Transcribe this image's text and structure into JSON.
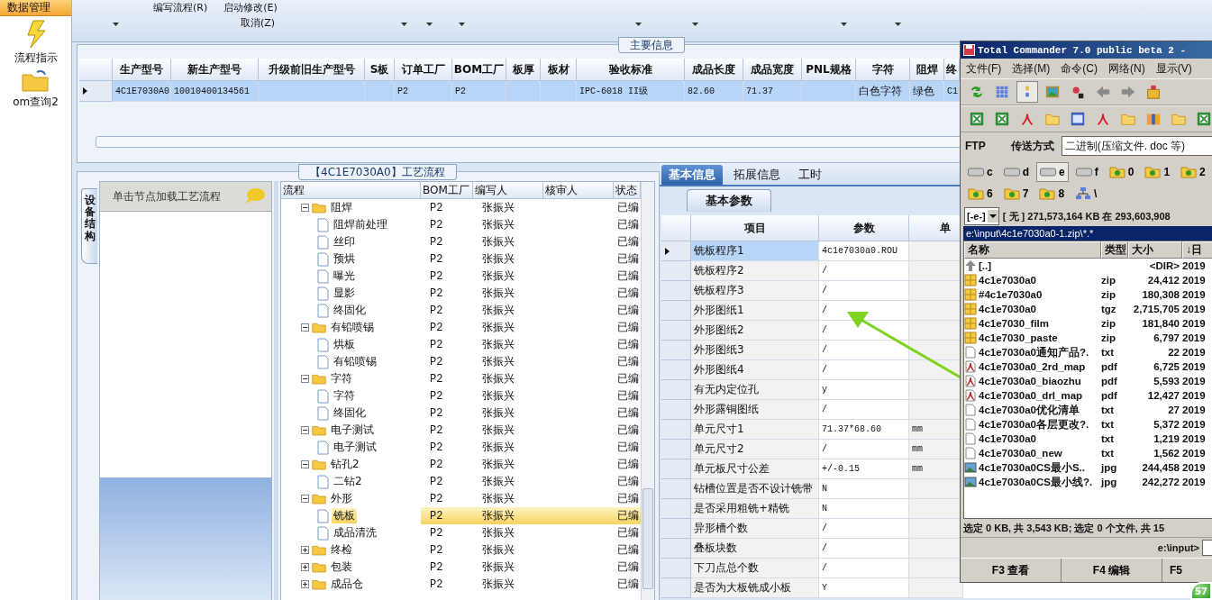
{
  "sidebar": {
    "header": "数据管理",
    "items": [
      {
        "label": "流程指示",
        "kind": "action"
      },
      {
        "label": "om查询2",
        "kind": "folder"
      }
    ]
  },
  "toolbar": {
    "top_items": [
      "编写流程(R)",
      "启动修改(E)"
    ],
    "bottom_item": "取消(Z)"
  },
  "main_info": {
    "title": "主要信息",
    "columns": [
      "生产型号",
      "新生产型号",
      "升级前旧生产型号",
      "S板",
      "订单工厂",
      "BOM工厂",
      "板厚",
      "板材",
      "验收标准",
      "成品长度",
      "成品宽度",
      "PNL规格",
      "字符",
      "阻焊",
      "终"
    ],
    "rows": [
      {
        "selected": true,
        "cells": [
          "4C1E7030A0",
          "10010400134561",
          "",
          "",
          "P2",
          "P2",
          "",
          "",
          "IPC-6018 II级",
          "82.60",
          "71.37",
          "",
          "白色字符",
          "绿色",
          "C1"
        ]
      }
    ]
  },
  "process": {
    "title": "【4C1E7030A0】工艺流程",
    "side_tab": "设备结构",
    "hint": "单击节点加载工艺流程",
    "columns": [
      "流程",
      "BOM工厂",
      "编写人",
      "核审人",
      "状态"
    ],
    "tree": [
      {
        "label": "阻焊",
        "kind": "folder",
        "expanded": true,
        "selected": false,
        "bom": "P2",
        "writer": "张振兴",
        "status": "已编",
        "children": [
          {
            "label": "阻焊前处理",
            "kind": "file",
            "selected": false,
            "bom": "P2",
            "writer": "张振兴",
            "status": "已编"
          },
          {
            "label": "丝印",
            "kind": "file",
            "selected": false,
            "bom": "P2",
            "writer": "张振兴",
            "status": "已编"
          },
          {
            "label": "预烘",
            "kind": "file",
            "selected": false,
            "bom": "P2",
            "writer": "张振兴",
            "status": "已编"
          },
          {
            "label": "曝光",
            "kind": "file",
            "selected": false,
            "bom": "P2",
            "writer": "张振兴",
            "status": "已编"
          },
          {
            "label": "显影",
            "kind": "file",
            "selected": false,
            "bom": "P2",
            "writer": "张振兴",
            "status": "已编"
          },
          {
            "label": "终固化",
            "kind": "file",
            "selected": false,
            "bom": "P2",
            "writer": "张振兴",
            "status": "已编"
          }
        ]
      },
      {
        "label": "有铅喷锡",
        "kind": "folder",
        "expanded": true,
        "selected": false,
        "bom": "P2",
        "writer": "张振兴",
        "status": "已编",
        "children": [
          {
            "label": "烘板",
            "kind": "file",
            "selected": false,
            "bom": "P2",
            "writer": "张振兴",
            "status": "已编"
          },
          {
            "label": "有铅喷锡",
            "kind": "file",
            "selected": false,
            "bom": "P2",
            "writer": "张振兴",
            "status": "已编"
          }
        ]
      },
      {
        "label": "字符",
        "kind": "folder",
        "expanded": true,
        "selected": false,
        "bom": "P2",
        "writer": "张振兴",
        "status": "已编",
        "children": [
          {
            "label": "字符",
            "kind": "file",
            "selected": false,
            "bom": "P2",
            "writer": "张振兴",
            "status": "已编"
          },
          {
            "label": "终固化",
            "kind": "file",
            "selected": false,
            "bom": "P2",
            "writer": "张振兴",
            "status": "已编"
          }
        ]
      },
      {
        "label": "电子测试",
        "kind": "folder",
        "expanded": true,
        "selected": false,
        "bom": "P2",
        "writer": "张振兴",
        "status": "已编",
        "children": [
          {
            "label": "电子测试",
            "kind": "file",
            "selected": false,
            "bom": "P2",
            "writer": "张振兴",
            "status": "已编"
          }
        ]
      },
      {
        "label": "钻孔2",
        "kind": "folder",
        "expanded": true,
        "selected": false,
        "bom": "P2",
        "writer": "张振兴",
        "status": "已编",
        "children": [
          {
            "label": "二钻2",
            "kind": "file",
            "selected": false,
            "bom": "P2",
            "writer": "张振兴",
            "status": "已编"
          }
        ]
      },
      {
        "label": "外形",
        "kind": "folder",
        "expanded": true,
        "selected": false,
        "bom": "P2",
        "writer": "张振兴",
        "status": "已编",
        "children": [
          {
            "label": "铣板",
            "kind": "file",
            "selected": true,
            "bom": "P2",
            "writer": "张振兴",
            "status": "已编"
          },
          {
            "label": "成品清洗",
            "kind": "file",
            "selected": false,
            "bom": "P2",
            "writer": "张振兴",
            "status": "已编"
          }
        ]
      },
      {
        "label": "终检",
        "kind": "folder",
        "expanded": false,
        "selected": false,
        "bom": "P2",
        "writer": "张振兴",
        "status": "已编"
      },
      {
        "label": "包装",
        "kind": "folder",
        "expanded": false,
        "selected": false,
        "bom": "P2",
        "writer": "张振兴",
        "status": "已编"
      },
      {
        "label": "成品仓",
        "kind": "folder",
        "expanded": false,
        "selected": false,
        "bom": "P2",
        "writer": "张振兴",
        "status": "已编"
      }
    ]
  },
  "detail": {
    "tabs": [
      {
        "label": "基本信息",
        "selected": true
      },
      {
        "label": "拓展信息",
        "selected": false
      },
      {
        "label": "工时",
        "selected": false
      }
    ],
    "subtab": "基本参数",
    "columns": [
      "项目",
      "参数",
      "单"
    ],
    "rows": [
      {
        "item": "铣板程序1",
        "value": "4c1e7030a0.ROU",
        "selected": true
      },
      {
        "item": "铣板程序2",
        "value": "/",
        "selected": false
      },
      {
        "item": "铣板程序3",
        "value": "/",
        "selected": false
      },
      {
        "item": "外形图纸1",
        "value": "/",
        "selected": false
      },
      {
        "item": "外形图纸2",
        "value": "/",
        "selected": false
      },
      {
        "item": "外形图纸3",
        "value": "/",
        "selected": false
      },
      {
        "item": "外形图纸4",
        "value": "/",
        "selected": false
      },
      {
        "item": "有无内定位孔",
        "value": "y",
        "selected": false
      },
      {
        "item": "外形露铜图纸",
        "value": "/",
        "selected": false
      },
      {
        "item": "单元尺寸1",
        "value": "71.37*68.60",
        "unit": "mm",
        "selected": false
      },
      {
        "item": "单元尺寸2",
        "value": "/",
        "unit": "mm",
        "selected": false
      },
      {
        "item": "单元板尺寸公差",
        "value": "+/-0.15",
        "unit": "mm",
        "selected": false
      },
      {
        "item": "钻槽位置是否不设计铣带",
        "value": "N",
        "selected": false
      },
      {
        "item": "是否采用粗铣+精铣",
        "value": "N",
        "selected": false
      },
      {
        "item": "异形槽个数",
        "value": "/",
        "selected": false
      },
      {
        "item": "叠板块数",
        "value": "/",
        "selected": false
      },
      {
        "item": "下刀点总个数",
        "value": "/",
        "selected": false
      },
      {
        "item": "是否为大板铣成小板",
        "value": "Y",
        "selected": false
      }
    ]
  },
  "file_manager": {
    "title": "Total Commander 7.0 public beta 2 -",
    "menu": [
      "文件(F)",
      "选择(M)",
      "命令(C)",
      "网络(N)",
      "显示(V)"
    ],
    "ftp_label": "FTP",
    "transfer_label": "传送方式",
    "transfer_mode": "二进制(压缩文件. doc 等)",
    "drives": [
      {
        "label": "c",
        "kind": "drive",
        "selected": false
      },
      {
        "label": "d",
        "kind": "drive",
        "selected": false
      },
      {
        "label": "e",
        "kind": "drive",
        "selected": true
      },
      {
        "label": "f",
        "kind": "drive",
        "selected": false
      },
      {
        "label": "0",
        "kind": "net-folder",
        "selected": false
      },
      {
        "label": "1",
        "kind": "net-folder",
        "selected": false
      },
      {
        "label": "2",
        "kind": "net-folder",
        "selected": false
      },
      {
        "label": "6",
        "kind": "net-folder",
        "selected": false
      },
      {
        "label": "7",
        "kind": "net-folder",
        "selected": false
      },
      {
        "label": "8",
        "kind": "net-folder",
        "selected": false
      },
      {
        "label": "\\",
        "kind": "network",
        "selected": false
      }
    ],
    "drive_select": "[-e-]",
    "free_space": "[ 无 ] 271,573,164 KB 在 293,603,908",
    "path": "e:\\input\\4c1e7030a0-1.zip\\*.*",
    "columns": [
      "名称",
      "类型",
      "大小",
      "↓日"
    ],
    "files": [
      {
        "name": "[..]",
        "size": "<DIR>",
        "date": "2019",
        "kind": "up"
      },
      {
        "name": "4c1e7030a0",
        "type": "zip",
        "size": "24,412",
        "date": "2019",
        "kind": "archive"
      },
      {
        "name": "#4c1e7030a0",
        "type": "zip",
        "size": "180,308",
        "date": "2019",
        "kind": "archive"
      },
      {
        "name": "4c1e7030a0",
        "type": "tgz",
        "size": "2,715,705",
        "date": "2019",
        "kind": "archive"
      },
      {
        "name": "4c1e7030_film",
        "type": "zip",
        "size": "181,840",
        "date": "2019",
        "kind": "archive"
      },
      {
        "name": "4c1e7030_paste",
        "type": "zip",
        "size": "6,797",
        "date": "2019",
        "kind": "archive"
      },
      {
        "name": "4c1e7030a0通知产品?.",
        "type": "txt",
        "size": "22",
        "date": "2019",
        "kind": "text"
      },
      {
        "name": "4c1e7030a0_2rd_map",
        "type": "pdf",
        "size": "6,725",
        "date": "2019",
        "kind": "pdf"
      },
      {
        "name": "4c1e7030a0_biaozhu",
        "type": "pdf",
        "size": "5,593",
        "date": "2019",
        "kind": "pdf"
      },
      {
        "name": "4c1e7030a0_drl_map",
        "type": "pdf",
        "size": "12,427",
        "date": "2019",
        "kind": "pdf"
      },
      {
        "name": "4c1e7030a0优化清单",
        "type": "txt",
        "size": "27",
        "date": "2019",
        "kind": "text"
      },
      {
        "name": "4c1e7030a0各层更改?.",
        "type": "txt",
        "size": "5,372",
        "date": "2019",
        "kind": "text"
      },
      {
        "name": "4c1e7030a0",
        "type": "txt",
        "size": "1,219",
        "date": "2019",
        "kind": "text"
      },
      {
        "name": "4c1e7030a0_new",
        "type": "txt",
        "size": "1,562",
        "date": "2019",
        "kind": "text"
      },
      {
        "name": "4c1e7030a0CS最小S..",
        "type": "jpg",
        "size": "244,458",
        "date": "2019",
        "kind": "image"
      },
      {
        "name": "4c1e7030a0CS最小线?.",
        "type": "jpg",
        "size": "242,272",
        "date": "2019",
        "kind": "image"
      }
    ],
    "status": "选定 0 KB, 共 3,543 KB; 选定 0 个文件, 共 15",
    "prompt": "e:\\input>",
    "fkeys": [
      "F3 查看",
      "F4 编辑",
      "F5"
    ]
  },
  "badge": "57"
}
